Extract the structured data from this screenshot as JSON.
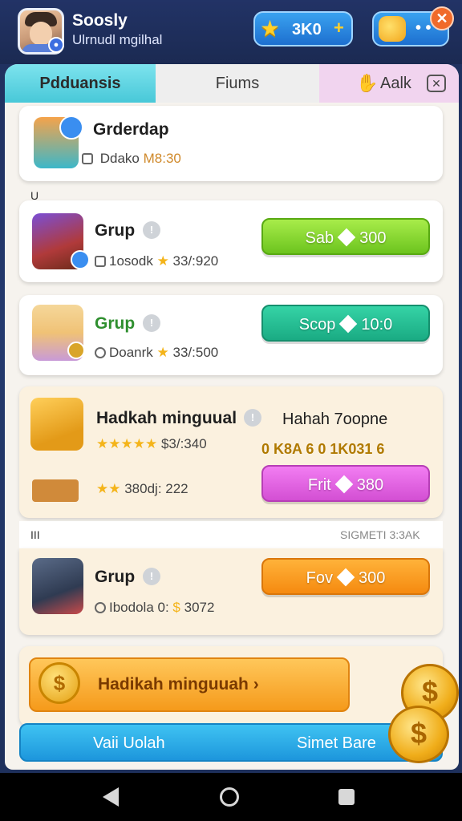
{
  "header": {
    "user_name": "Soosly",
    "user_subtitle": "Ulrnudl mgilhal",
    "stars_value": "3K0",
    "plus_label": "+"
  },
  "tabs": [
    {
      "label": "Pdduansis"
    },
    {
      "label": "Fiums"
    },
    {
      "label": "Aalk"
    }
  ],
  "cards": {
    "top": {
      "title": "Grderdap",
      "sub_label": "Ddako",
      "sub_value": "M8:30"
    },
    "section1_label": "U",
    "c1": {
      "title": "Grup",
      "left": "1osodk",
      "right": "33/:920",
      "button": "Sab",
      "price": "300"
    },
    "c2": {
      "title": "Grup",
      "left": "Doanrk",
      "right": "33/:500",
      "button": "Scop",
      "price": "10:0"
    },
    "c3": {
      "title": "Hadkah minguual",
      "rating": "$3/:340",
      "side_title": "Hahah 7oopne",
      "side_stats": "0 K8A 6 0 1K031 6",
      "left2": "380dj: 222",
      "button": "Frit",
      "price": "380"
    },
    "section2_left": "III",
    "section2_right": "SIGMETI 3:3AK",
    "c4": {
      "title": "Grup",
      "left": "Ibodola 0:",
      "right": "3072",
      "button": "Fov",
      "price": "300"
    }
  },
  "banner": {
    "text": "Hadikah minguuah",
    "arrow": "›"
  },
  "bottom_bar": {
    "left": "Vaii Uolah",
    "right": "Simet Bare"
  },
  "colors": {
    "green_button": "#6cc41e",
    "teal_button": "#1aab83",
    "pink_button": "#d34fd3",
    "orange_button": "#f58a10",
    "tab_active": "#48c8d8"
  }
}
